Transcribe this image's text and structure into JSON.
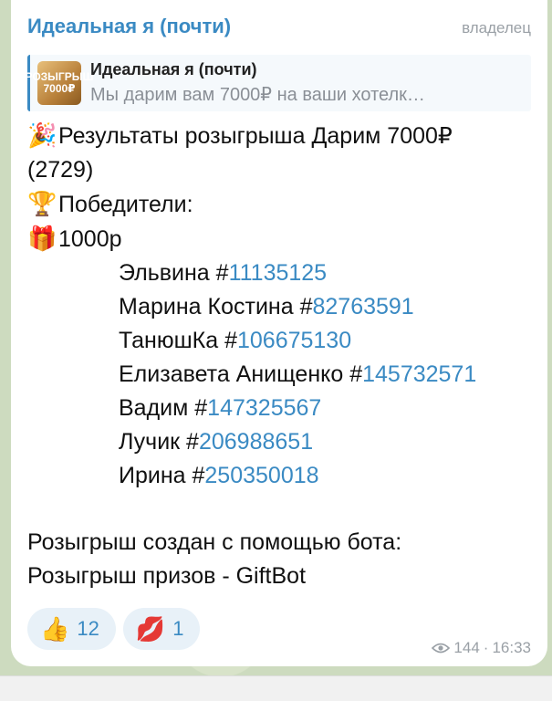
{
  "channel": {
    "name": "Идеальная я (почти)",
    "badge": "владелец"
  },
  "reply": {
    "thumb_text": "РОЗЫГРЫШ 7000₽",
    "title": "Идеальная я (почти)",
    "snippet": "Мы дарим вам 7000₽ на ваши хотелк…"
  },
  "message": {
    "emoji_party": "🎉",
    "title_line1": "Результаты розыгрыша Дарим 7000₽",
    "title_line2": "(2729)",
    "emoji_trophy": "🏆",
    "winners_label": "Победители:",
    "emoji_gift": "🎁",
    "prize": "1000р",
    "winners": [
      {
        "name": "Эльвина #",
        "ticket": "11135125"
      },
      {
        "name": "Марина Костина #",
        "ticket": "82763591"
      },
      {
        "name": "ТанюшКа #",
        "ticket": "106675130"
      },
      {
        "name": "Елизавета Анищенко #",
        "ticket": "145732571"
      },
      {
        "name": "Вадим #",
        "ticket": "147325567"
      },
      {
        "name": "Лучик #",
        "ticket": "206988651"
      },
      {
        "name": "Ирина #",
        "ticket": "250350018"
      }
    ],
    "footer_line1": "Розыгрыш создан с помощью бота:",
    "footer_line2": "Розыгрыш призов - GiftBot"
  },
  "reactions": [
    {
      "emoji": "👍",
      "count": "12"
    },
    {
      "emoji": "💋",
      "count": "1"
    }
  ],
  "meta": {
    "views": "144",
    "separator": "·",
    "time": "16:33",
    "icon": "eye-icon"
  },
  "colors": {
    "accent": "#3a8ac3",
    "muted": "#9aa0a6",
    "wallpaper": "#cddbbf"
  }
}
